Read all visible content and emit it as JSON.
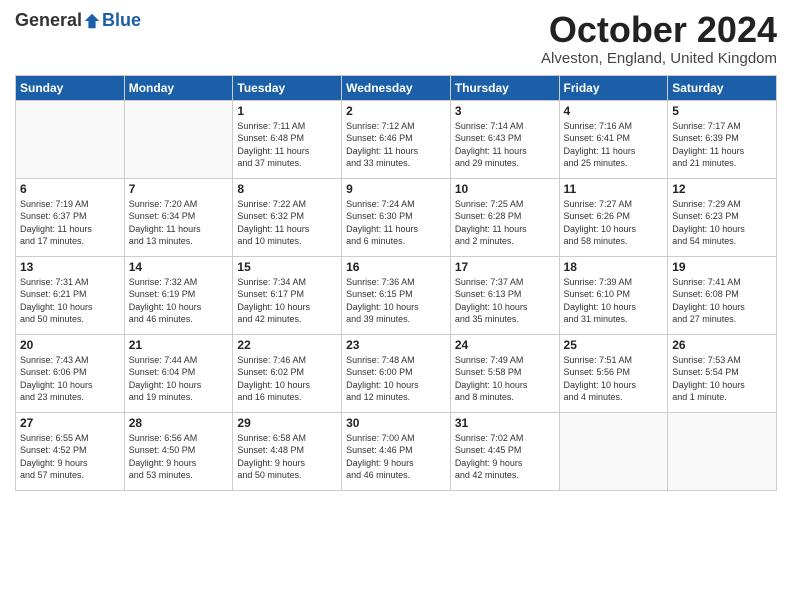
{
  "logo": {
    "general": "General",
    "blue": "Blue"
  },
  "title": "October 2024",
  "location": "Alveston, England, United Kingdom",
  "days_of_week": [
    "Sunday",
    "Monday",
    "Tuesday",
    "Wednesday",
    "Thursday",
    "Friday",
    "Saturday"
  ],
  "weeks": [
    [
      {
        "day": "",
        "detail": ""
      },
      {
        "day": "",
        "detail": ""
      },
      {
        "day": "1",
        "detail": "Sunrise: 7:11 AM\nSunset: 6:48 PM\nDaylight: 11 hours\nand 37 minutes."
      },
      {
        "day": "2",
        "detail": "Sunrise: 7:12 AM\nSunset: 6:46 PM\nDaylight: 11 hours\nand 33 minutes."
      },
      {
        "day": "3",
        "detail": "Sunrise: 7:14 AM\nSunset: 6:43 PM\nDaylight: 11 hours\nand 29 minutes."
      },
      {
        "day": "4",
        "detail": "Sunrise: 7:16 AM\nSunset: 6:41 PM\nDaylight: 11 hours\nand 25 minutes."
      },
      {
        "day": "5",
        "detail": "Sunrise: 7:17 AM\nSunset: 6:39 PM\nDaylight: 11 hours\nand 21 minutes."
      }
    ],
    [
      {
        "day": "6",
        "detail": "Sunrise: 7:19 AM\nSunset: 6:37 PM\nDaylight: 11 hours\nand 17 minutes."
      },
      {
        "day": "7",
        "detail": "Sunrise: 7:20 AM\nSunset: 6:34 PM\nDaylight: 11 hours\nand 13 minutes."
      },
      {
        "day": "8",
        "detail": "Sunrise: 7:22 AM\nSunset: 6:32 PM\nDaylight: 11 hours\nand 10 minutes."
      },
      {
        "day": "9",
        "detail": "Sunrise: 7:24 AM\nSunset: 6:30 PM\nDaylight: 11 hours\nand 6 minutes."
      },
      {
        "day": "10",
        "detail": "Sunrise: 7:25 AM\nSunset: 6:28 PM\nDaylight: 11 hours\nand 2 minutes."
      },
      {
        "day": "11",
        "detail": "Sunrise: 7:27 AM\nSunset: 6:26 PM\nDaylight: 10 hours\nand 58 minutes."
      },
      {
        "day": "12",
        "detail": "Sunrise: 7:29 AM\nSunset: 6:23 PM\nDaylight: 10 hours\nand 54 minutes."
      }
    ],
    [
      {
        "day": "13",
        "detail": "Sunrise: 7:31 AM\nSunset: 6:21 PM\nDaylight: 10 hours\nand 50 minutes."
      },
      {
        "day": "14",
        "detail": "Sunrise: 7:32 AM\nSunset: 6:19 PM\nDaylight: 10 hours\nand 46 minutes."
      },
      {
        "day": "15",
        "detail": "Sunrise: 7:34 AM\nSunset: 6:17 PM\nDaylight: 10 hours\nand 42 minutes."
      },
      {
        "day": "16",
        "detail": "Sunrise: 7:36 AM\nSunset: 6:15 PM\nDaylight: 10 hours\nand 39 minutes."
      },
      {
        "day": "17",
        "detail": "Sunrise: 7:37 AM\nSunset: 6:13 PM\nDaylight: 10 hours\nand 35 minutes."
      },
      {
        "day": "18",
        "detail": "Sunrise: 7:39 AM\nSunset: 6:10 PM\nDaylight: 10 hours\nand 31 minutes."
      },
      {
        "day": "19",
        "detail": "Sunrise: 7:41 AM\nSunset: 6:08 PM\nDaylight: 10 hours\nand 27 minutes."
      }
    ],
    [
      {
        "day": "20",
        "detail": "Sunrise: 7:43 AM\nSunset: 6:06 PM\nDaylight: 10 hours\nand 23 minutes."
      },
      {
        "day": "21",
        "detail": "Sunrise: 7:44 AM\nSunset: 6:04 PM\nDaylight: 10 hours\nand 19 minutes."
      },
      {
        "day": "22",
        "detail": "Sunrise: 7:46 AM\nSunset: 6:02 PM\nDaylight: 10 hours\nand 16 minutes."
      },
      {
        "day": "23",
        "detail": "Sunrise: 7:48 AM\nSunset: 6:00 PM\nDaylight: 10 hours\nand 12 minutes."
      },
      {
        "day": "24",
        "detail": "Sunrise: 7:49 AM\nSunset: 5:58 PM\nDaylight: 10 hours\nand 8 minutes."
      },
      {
        "day": "25",
        "detail": "Sunrise: 7:51 AM\nSunset: 5:56 PM\nDaylight: 10 hours\nand 4 minutes."
      },
      {
        "day": "26",
        "detail": "Sunrise: 7:53 AM\nSunset: 5:54 PM\nDaylight: 10 hours\nand 1 minute."
      }
    ],
    [
      {
        "day": "27",
        "detail": "Sunrise: 6:55 AM\nSunset: 4:52 PM\nDaylight: 9 hours\nand 57 minutes."
      },
      {
        "day": "28",
        "detail": "Sunrise: 6:56 AM\nSunset: 4:50 PM\nDaylight: 9 hours\nand 53 minutes."
      },
      {
        "day": "29",
        "detail": "Sunrise: 6:58 AM\nSunset: 4:48 PM\nDaylight: 9 hours\nand 50 minutes."
      },
      {
        "day": "30",
        "detail": "Sunrise: 7:00 AM\nSunset: 4:46 PM\nDaylight: 9 hours\nand 46 minutes."
      },
      {
        "day": "31",
        "detail": "Sunrise: 7:02 AM\nSunset: 4:45 PM\nDaylight: 9 hours\nand 42 minutes."
      },
      {
        "day": "",
        "detail": ""
      },
      {
        "day": "",
        "detail": ""
      }
    ]
  ]
}
